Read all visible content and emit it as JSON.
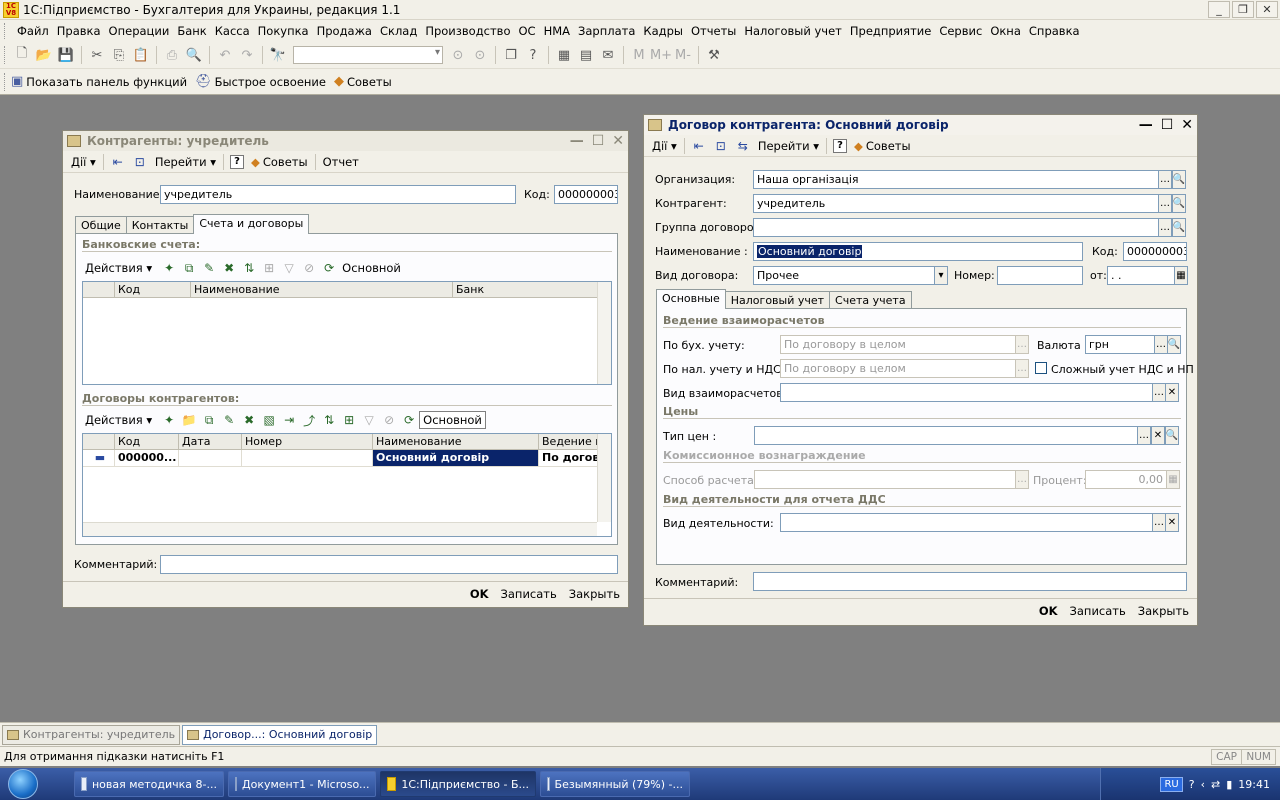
{
  "app": {
    "logo": "1С V8",
    "title": "1С:Підприємство - Бухгалтерия для Украины, редакция 1.1",
    "menu": [
      "Файл",
      "Правка",
      "Операции",
      "Банк",
      "Касса",
      "Покупка",
      "Продажа",
      "Склад",
      "Производство",
      "ОС",
      "НМА",
      "Зарплата",
      "Кадры",
      "Отчеты",
      "Налоговый учет",
      "Предприятие",
      "Сервис",
      "Окна",
      "Справка"
    ],
    "toolbar2": {
      "show_panel": "Показать панель функций",
      "quick_learn": "Быстрое освоение",
      "tips": "Советы"
    }
  },
  "win1": {
    "title": "Контрагенты: учредитель",
    "toolbar": {
      "actions": "Дії",
      "goto": "Перейти",
      "tips": "Советы",
      "report": "Отчет"
    },
    "name_label": "Наименование:",
    "name_value": "учредитель",
    "code_label": "Код:",
    "code_value": "000000003",
    "tabs": [
      "Общие",
      "Контакты",
      "Счета и договоры"
    ],
    "bank_section": "Банковские счета:",
    "bank_toolbar": {
      "actions": "Действия",
      "main": "Основной"
    },
    "bank_columns": [
      "Код",
      "Наименование",
      "Банк"
    ],
    "contracts_section": "Договоры контрагентов:",
    "contracts_toolbar": {
      "actions": "Действия",
      "main": "Основной"
    },
    "contracts_columns": [
      "Код",
      "Дата",
      "Номер",
      "Наименование",
      "Ведение вз"
    ],
    "contracts_rows": [
      {
        "code": "000000...",
        "date": "",
        "number": "",
        "name": "Основний договір",
        "conduct": "По догово"
      }
    ],
    "comment_label": "Комментарий:",
    "comment_value": "",
    "buttons": {
      "ok": "OK",
      "save": "Записать",
      "close": "Закрыть"
    }
  },
  "win2": {
    "title": "Договор контрагента: Основний договір",
    "toolbar": {
      "actions": "Дії",
      "goto": "Перейти",
      "tips": "Советы"
    },
    "org_label": "Организация:",
    "org_value": "Наша організація",
    "counterparty_label": "Контрагент:",
    "counterparty_value": "учредитель",
    "group_label": "Группа договоров:",
    "group_value": "",
    "name_label": "Наименование :",
    "name_value": "Основний договір",
    "code_label": "Код:",
    "code_value": "000000003",
    "type_label": "Вид договора:",
    "type_value": "Прочее",
    "number_label": "Номер:",
    "number_value": "",
    "from_label": "от:",
    "from_value": " .  .",
    "tabs": [
      "Основные",
      "Налоговый учет",
      "Счета учета"
    ],
    "sec_settlements": "Ведение взаиморасчетов",
    "acc_label": "По бух. учету:",
    "acc_value": "По договору в целом",
    "currency_label": "Валюта :",
    "currency_value": "грн",
    "tax_label": "По нал. учету и НДС:",
    "tax_value": "По договору в целом",
    "complex_label": "Сложный  учет НДС и НП",
    "settle_type_label": "Вид взаиморасчетов:",
    "settle_type_value": "",
    "sec_prices": "Цены",
    "price_type_label": "Тип цен :",
    "price_type_value": "",
    "sec_commission": "Комиссионное вознаграждение",
    "calc_method_label": "Способ расчета:",
    "calc_method_value": "",
    "percent_label": "Процент:",
    "percent_value": "0,00",
    "sec_activity": "Вид деятельности для отчета ДДС",
    "activity_label": "Вид деятельности:",
    "activity_value": "",
    "comment_label": "Комментарий:",
    "comment_value": "",
    "buttons": {
      "ok": "OK",
      "save": "Записать",
      "close": "Закрыть"
    }
  },
  "window_bar": [
    "Контрагенты: учредитель",
    "Договор...: Основний договір"
  ],
  "status": {
    "hint": "Для отримання підказки натисніть F1",
    "cap": "CAP",
    "num": "NUM"
  },
  "taskbar": {
    "items": [
      "новая методичка 8-...",
      "Документ1 - Microso...",
      "1С:Підприємство - Б...",
      "Безымянный (79%) -..."
    ],
    "lang": "RU",
    "time": "19:41"
  }
}
